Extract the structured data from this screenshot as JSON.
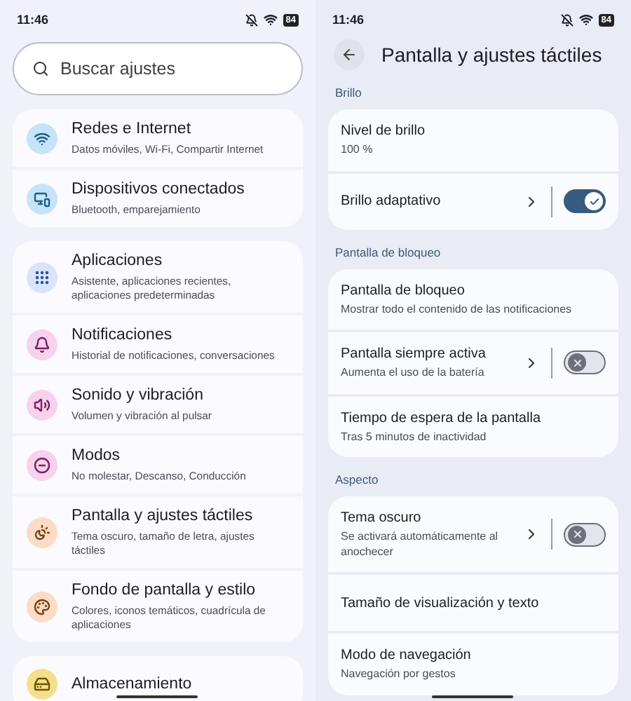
{
  "left": {
    "status": {
      "time": "11:46",
      "battery": "84"
    },
    "search": {
      "placeholder": "Buscar ajustes"
    },
    "groups": [
      {
        "items": [
          {
            "title": "Redes e Internet",
            "subtitle": "Datos móviles, Wi-Fi, Compartir Internet",
            "color": "#c5e4fa"
          },
          {
            "title": "Dispositivos conectados",
            "subtitle": "Bluetooth, emparejamiento",
            "color": "#c5e4fa"
          }
        ]
      },
      {
        "items": [
          {
            "title": "Aplicaciones",
            "subtitle": "Asistente, aplicaciones recientes, aplicaciones predeterminadas",
            "color": "#d9e3fa"
          },
          {
            "title": "Notificaciones",
            "subtitle": "Historial de notificaciones, conversaciones",
            "color": "#f7d2ec"
          },
          {
            "title": "Sonido y vibración",
            "subtitle": "Volumen y vibración al pulsar",
            "color": "#f7d2ec"
          },
          {
            "title": "Modos",
            "subtitle": "No molestar, Descanso, Conducción",
            "color": "#f7d2ec"
          },
          {
            "title": "Pantalla y ajustes táctiles",
            "subtitle": "Tema oscuro, tamaño de letra, ajustes táctiles",
            "color": "#fbdcc6"
          },
          {
            "title": "Fondo de pantalla y estilo",
            "subtitle": "Colores, iconos temáticos, cuadrícula de aplicaciones",
            "color": "#fbdcc6"
          }
        ]
      },
      {
        "items": [
          {
            "title": "Almacenamiento",
            "color": "#f5df8a"
          }
        ]
      }
    ]
  },
  "right": {
    "status": {
      "time": "11:46",
      "battery": "84"
    },
    "title": "Pantalla y ajustes táctiles",
    "sections": [
      {
        "label": "Brillo",
        "items": [
          {
            "kind": "plain",
            "title": "Nivel de brillo",
            "subtitle": "100 %"
          },
          {
            "kind": "toggle",
            "title": "Brillo adaptativo",
            "on": true
          }
        ]
      },
      {
        "label": "Pantalla de bloqueo",
        "items": [
          {
            "kind": "plain",
            "title": "Pantalla de bloqueo",
            "subtitle": "Mostrar todo el contenido de las notificaciones"
          },
          {
            "kind": "toggle",
            "title": "Pantalla siempre activa",
            "subtitle": "Aumenta el uso de la batería",
            "on": false
          },
          {
            "kind": "plain",
            "title": "Tiempo de espera de la pantalla",
            "subtitle": "Tras 5 minutos de inactividad"
          }
        ]
      },
      {
        "label": "Aspecto",
        "items": [
          {
            "kind": "toggle",
            "title": "Tema oscuro",
            "subtitle": "Se activará automáticamente al anochecer",
            "on": false
          },
          {
            "kind": "plain",
            "title": "Tamaño de visualización y texto"
          },
          {
            "kind": "plain",
            "title": "Modo de navegación",
            "subtitle": "Navegación por gestos"
          }
        ]
      }
    ]
  }
}
